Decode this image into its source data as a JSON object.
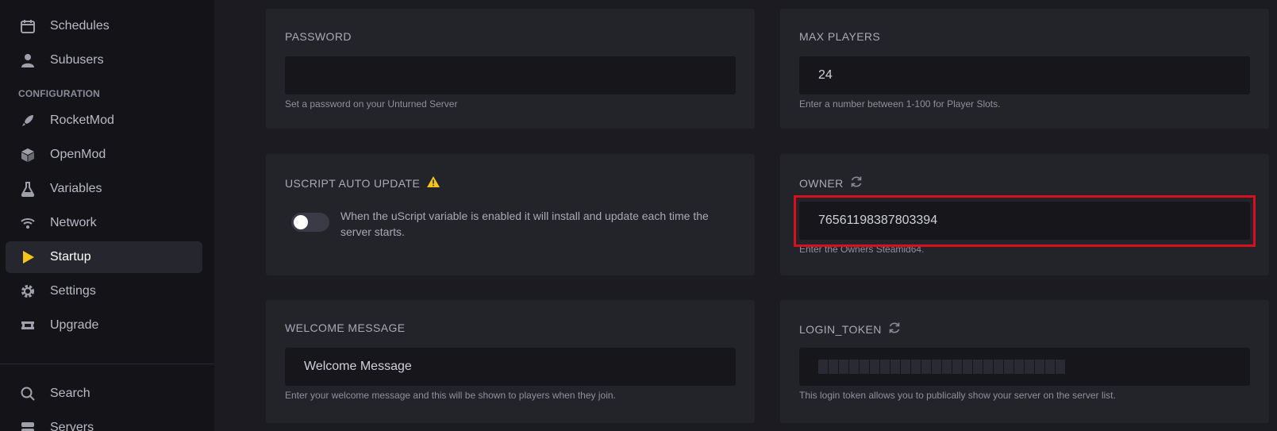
{
  "sidebar": {
    "items": [
      {
        "label": "Schedules",
        "icon": "calendar-icon"
      },
      {
        "label": "Subusers",
        "icon": "user-icon"
      },
      {
        "label": "RocketMod",
        "icon": "rocket-icon"
      },
      {
        "label": "OpenMod",
        "icon": "cube-icon"
      },
      {
        "label": "Variables",
        "icon": "flask-icon"
      },
      {
        "label": "Network",
        "icon": "wifi-icon"
      },
      {
        "label": "Startup",
        "icon": "play-icon",
        "active": true
      },
      {
        "label": "Settings",
        "icon": "gear-icon"
      },
      {
        "label": "Upgrade",
        "icon": "ticket-icon"
      },
      {
        "label": "Search",
        "icon": "search-icon"
      },
      {
        "label": "Servers",
        "icon": "server-icon"
      }
    ],
    "section_label": "CONFIGURATION",
    "active_color": "#f5c518"
  },
  "cards": {
    "password": {
      "title": "PASSWORD",
      "value": "",
      "help": "Set a password on your Unturned Server"
    },
    "max_players": {
      "title": "MAX PLAYERS",
      "value": "24",
      "help": "Enter a number between 1-100 for Player Slots."
    },
    "uscript": {
      "title": "USCRIPT AUTO UPDATE",
      "warning_icon": "warning-icon",
      "toggle_on": false,
      "description": "When the uScript variable is enabled it will install and update each time the server starts."
    },
    "owner": {
      "title": "OWNER",
      "refresh_icon": "refresh-icon",
      "value": "76561198387803394",
      "help": "Enter the Owners Steamid64."
    },
    "welcome": {
      "title": "WELCOME MESSAGE",
      "value": "Welcome Message",
      "help": "Enter your welcome message and this will be shown to players when they join."
    },
    "login_token": {
      "title": "LOGIN_TOKEN",
      "refresh_icon": "refresh-icon",
      "value_redacted": true,
      "help": "This login token allows you to publically show your server on the server list."
    }
  },
  "highlight_color": "#d8101d"
}
